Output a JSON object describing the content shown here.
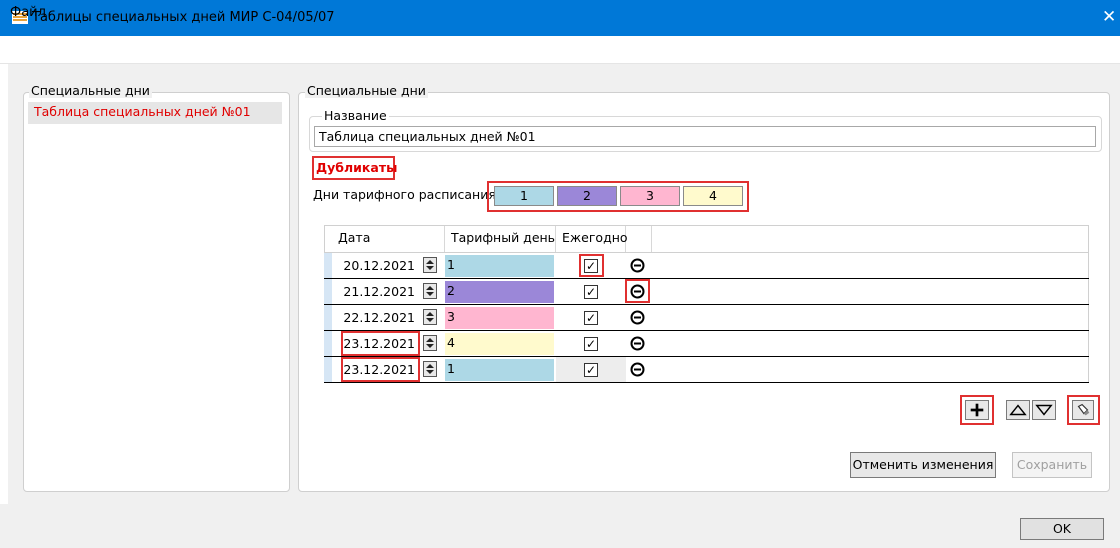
{
  "window": {
    "title": "Таблицы специальных дней МИР С-04/05/07",
    "close": "✕"
  },
  "menu": {
    "file": "Файл"
  },
  "left_panel": {
    "group_label": "Специальные дни",
    "items": [
      "Таблица специальных дней №01"
    ]
  },
  "right_panel": {
    "group_label": "Специальные дни",
    "name_label": "Название",
    "name_value": "Таблица специальных дней №01",
    "duplicates_label": "Дубликаты",
    "schedule_label": "Дни тарифного расписания:",
    "schedule_days": [
      {
        "label": "1",
        "color": "#add8e6"
      },
      {
        "label": "2",
        "color": "#9b87d8"
      },
      {
        "label": "3",
        "color": "#ffb6d0"
      },
      {
        "label": "4",
        "color": "#fffacd"
      }
    ]
  },
  "table": {
    "headers": [
      "Дата",
      "Тарифный день",
      "Ежегодно"
    ],
    "rows": [
      {
        "date": "20.12.2021",
        "tariff": "1",
        "color": "#add8e6",
        "yearly": "✓"
      },
      {
        "date": "21.12.2021",
        "tariff": "2",
        "color": "#9b87d8",
        "yearly": "✓"
      },
      {
        "date": "22.12.2021",
        "tariff": "3",
        "color": "#ffb6d0",
        "yearly": "✓"
      },
      {
        "date": "23.12.2021",
        "tariff": "4",
        "color": "#fffacd",
        "yearly": "✓"
      },
      {
        "date": "23.12.2021",
        "tariff": "1",
        "color": "#add8e6",
        "yearly": "✓"
      }
    ]
  },
  "buttons": {
    "cancel": "Отменить изменения",
    "save": "Сохранить",
    "ok": "OK"
  }
}
